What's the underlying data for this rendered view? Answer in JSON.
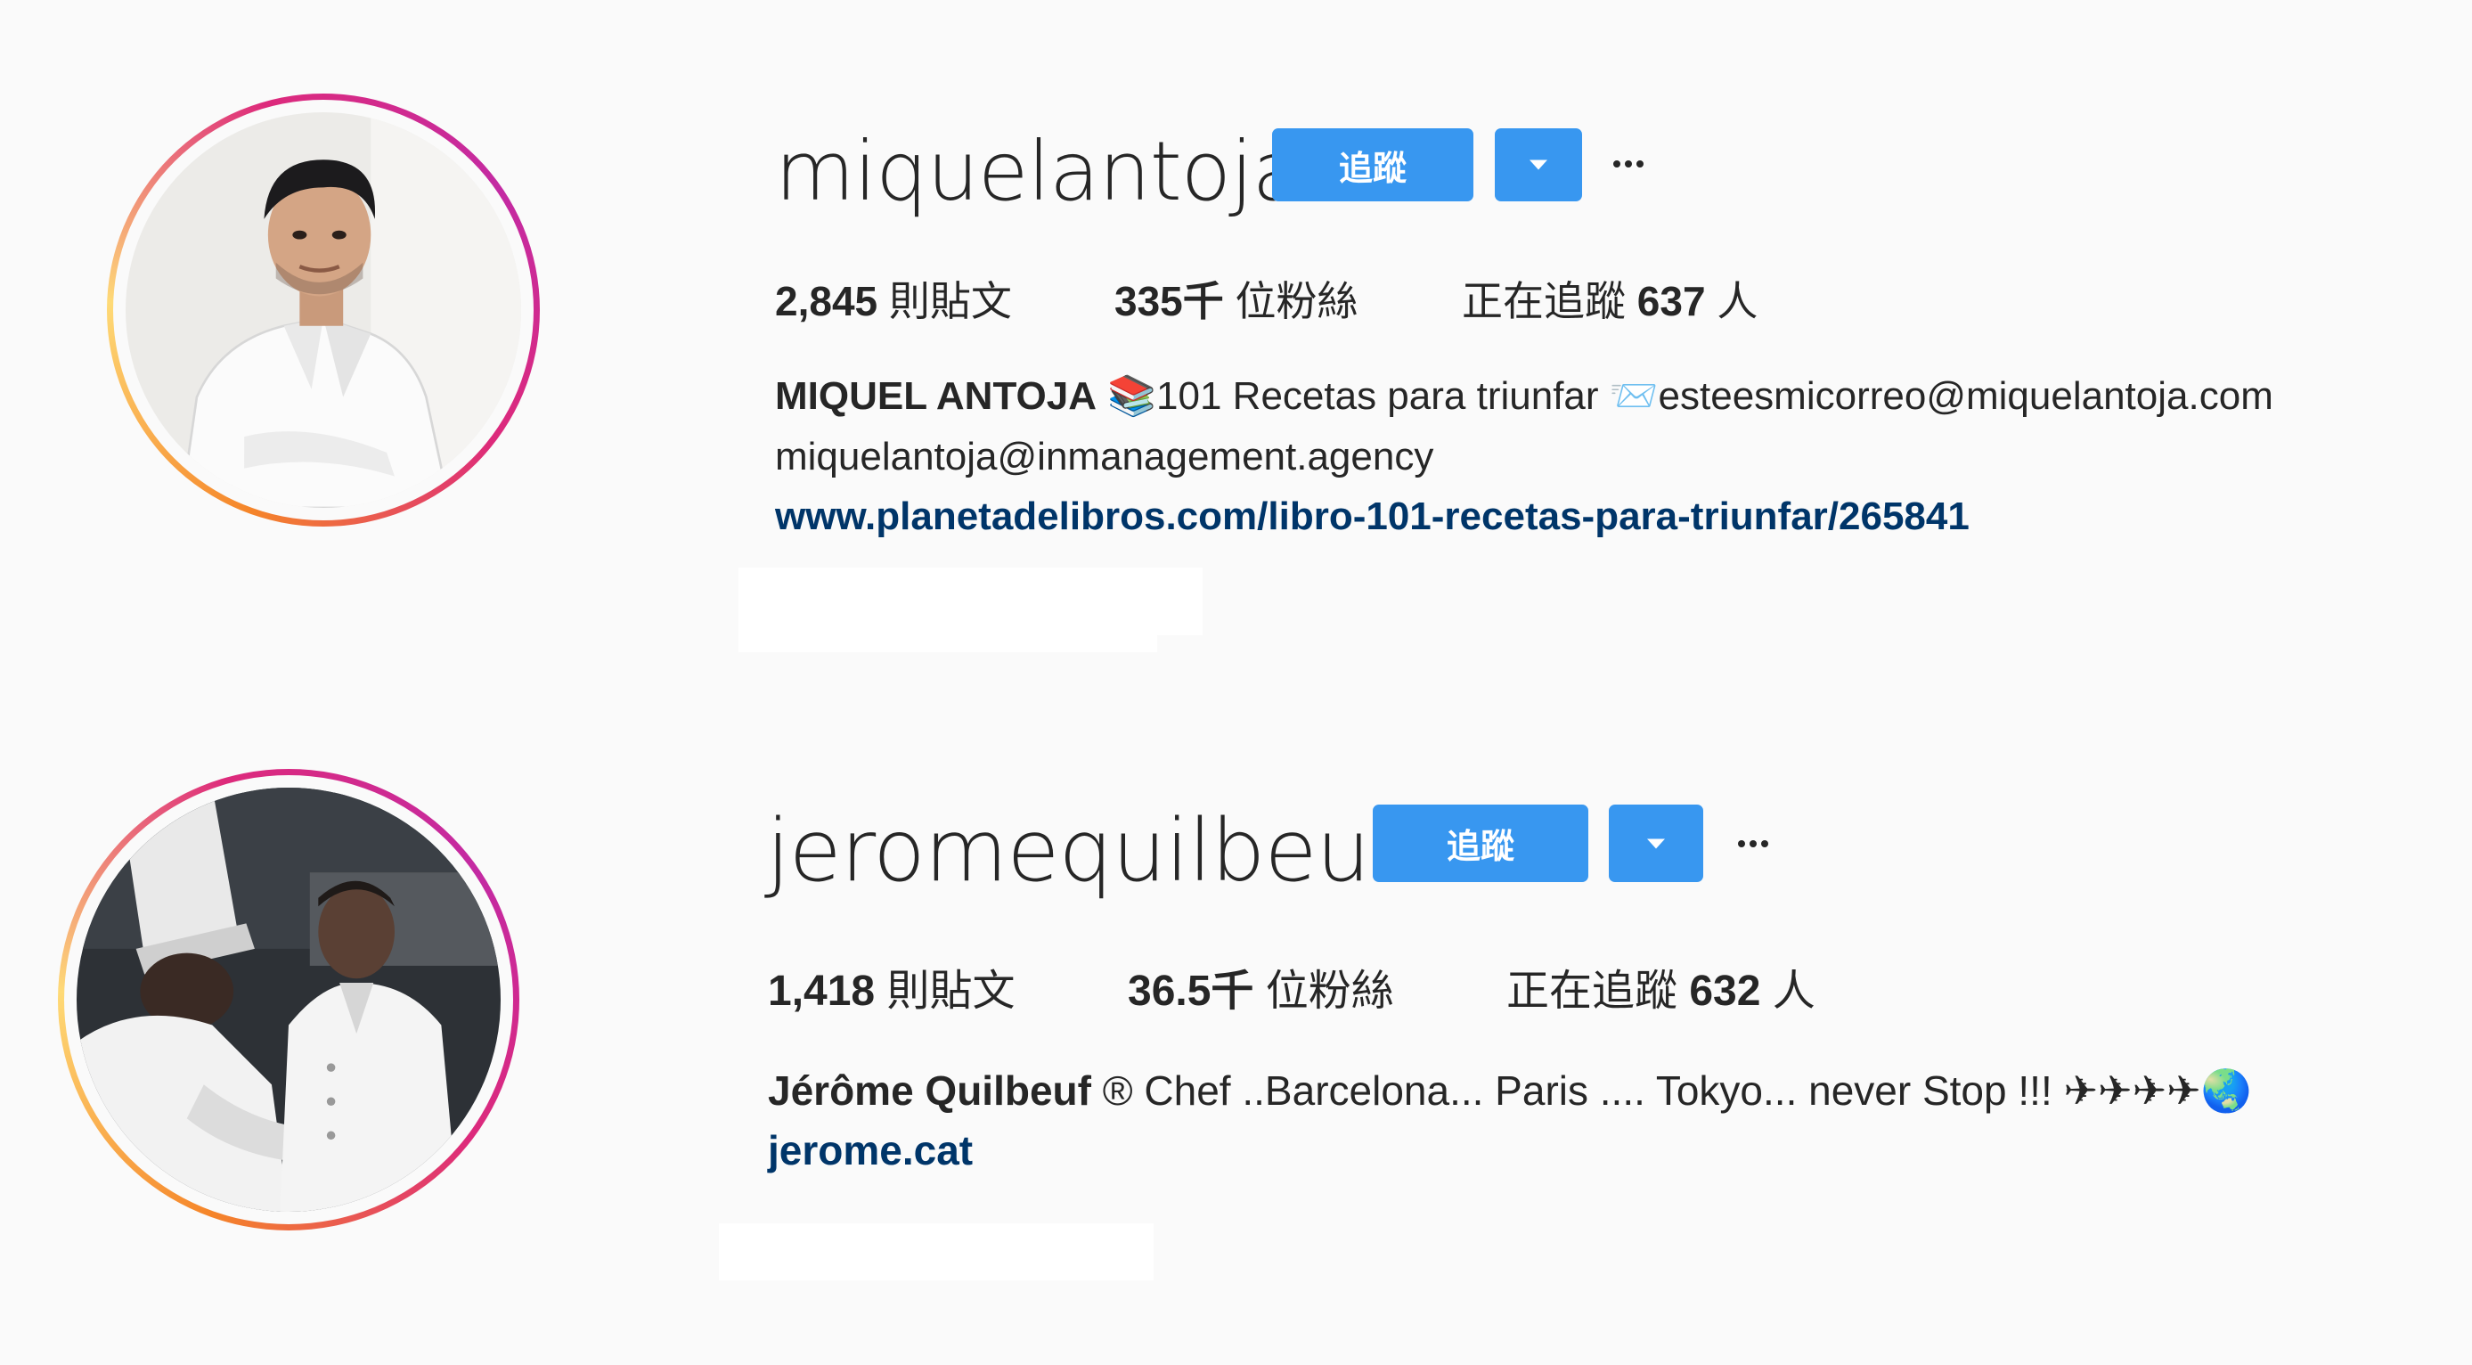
{
  "profiles": [
    {
      "username": "miquelantoja",
      "follow_label": "追蹤",
      "posts_count": "2,845",
      "posts_label": "則貼文",
      "followers_count": "335千",
      "followers_label": "位粉絲",
      "following_prefix": "正在追蹤",
      "following_count": "637",
      "following_suffix": "人",
      "full_name": "MIQUEL ANTOJA",
      "bio_line1": "📚101 Recetas para triunfar 📨esteesmicorreo@miquelantoja.com",
      "bio_line2": "miquelantoja@inmanagement.agency",
      "website": "www.planetadelibros.com/libro-101-recetas-para-triunfar/265841",
      "accent_color": "#3897f0"
    },
    {
      "username": "jeromequilbeuf",
      "follow_label": "追蹤",
      "posts_count": "1,418",
      "posts_label": "則貼文",
      "followers_count": "36.5千",
      "followers_label": "位粉絲",
      "following_prefix": "正在追蹤",
      "following_count": "632",
      "following_suffix": "人",
      "full_name": "Jérôme Quilbeuf",
      "bio_line1": "® Chef ..Barcelona... Paris .... Tokyo... never Stop !!! ✈✈✈✈🌏",
      "website": "jerome.cat",
      "accent_color": "#3897f0"
    }
  ],
  "icons": {
    "dropdown": "chevron-down-icon",
    "more": "more-options-icon"
  }
}
